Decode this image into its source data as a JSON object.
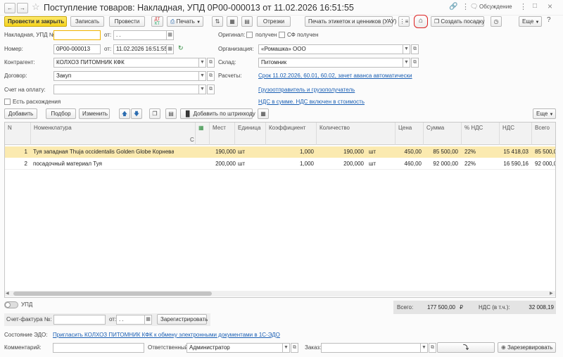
{
  "window": {
    "title": "Поступление товаров: Накладная, УПД 0Р00-000013 от 11.02.2026 16:51:55",
    "discussion": "Обсуждение"
  },
  "toolbar": {
    "post_close": "Провести и закрыть",
    "save": "Записать",
    "post": "Провести",
    "print": "Печать",
    "cuts": "Отрезки",
    "print_labels": "Печать этикеток и ценников (УАУ)",
    "create_planting": "Создать посадку",
    "more": "Еще"
  },
  "form": {
    "invoice_label": "Накладная, УПД №:",
    "invoice_number": "",
    "from_label": "от:",
    "invoice_date": ". .",
    "original_label": "Оригинал:",
    "received": "получен",
    "sf_received": "СФ получен",
    "number_label": "Номер:",
    "number": "0Р00-000013",
    "date": "11.02.2026 16:51:55",
    "org_label": "Организация:",
    "org": "«Ромашка» ООО",
    "contractor_label": "Контрагент:",
    "contractor": "КОЛХОЗ ПИТОМНИК КФК",
    "warehouse_label": "Склад:",
    "warehouse": "Питомник",
    "contract_label": "Договор:",
    "contract": "Закуп",
    "settlements_label": "Расчеты:",
    "settlements_link": "Срок 11.02.2026, 60.01, 60.02, зачет аванса автоматически",
    "payment_label": "Счет на оплату:",
    "payment": "",
    "shipper_link": "Грузоотправитель и грузополучатель",
    "discrepancy": "Есть расхождения",
    "vat_link": "НДС в сумме. НДС включен в стоимость"
  },
  "table_toolbar": {
    "add": "Добавить",
    "pick": "Подбор",
    "change": "Изменить",
    "barcode": "Добавить по штрихкоду",
    "more": "Еще"
  },
  "table": {
    "headers": {
      "n": "N",
      "item": "Номенклатура",
      "places": "Мест",
      "unit": "Единица",
      "coef": "Коэффициент",
      "qty": "Количество",
      "price": "Цена",
      "sum": "Сумма",
      "vat_pct": "% НДС",
      "vat": "НДС",
      "total": "Всего",
      "c": "С"
    },
    "rows": [
      {
        "n": "1",
        "item": "Туя западная Thuja occidentalis Golden Globe  Корневая ...",
        "places": "190,000",
        "unit": "шт",
        "coef": "1,000",
        "qty": "190,000",
        "qty_unit": "шт",
        "price": "450,00",
        "sum": "85 500,00",
        "vat_pct": "22%",
        "vat": "15 418,03",
        "total": "85 500,0"
      },
      {
        "n": "2",
        "item": "посадочный материал Туя",
        "places": "200,000",
        "unit": "шт",
        "coef": "1,000",
        "qty": "200,000",
        "qty_unit": "шт",
        "price": "460,00",
        "sum": "92 000,00",
        "vat_pct": "22%",
        "vat": "16 590,16",
        "total": "92 000,0"
      }
    ]
  },
  "totals": {
    "total_label": "Всего:",
    "total": "177 500,00",
    "currency": "₽",
    "vat_label": "НДС (в т.ч.):",
    "vat": "32 008,19"
  },
  "footer": {
    "upd_label": "УПД",
    "sf_label": "Счет-фактура №:",
    "sf_number": "",
    "sf_from": "от:",
    "sf_date": ". .",
    "register": "Зарегистрировать",
    "edo_label": "Состояние ЭДО:",
    "edo_link": "Пригласить КОЛХОЗ ПИТОМНИК КФК к обмену электронными документами в 1С-ЭДО",
    "comment_label": "Комментарий:",
    "comment": "",
    "responsible_label": "Ответственный:",
    "responsible": "Администратор",
    "order_label": "Заказ:",
    "order": "",
    "reserve": "Зарезервировать"
  }
}
